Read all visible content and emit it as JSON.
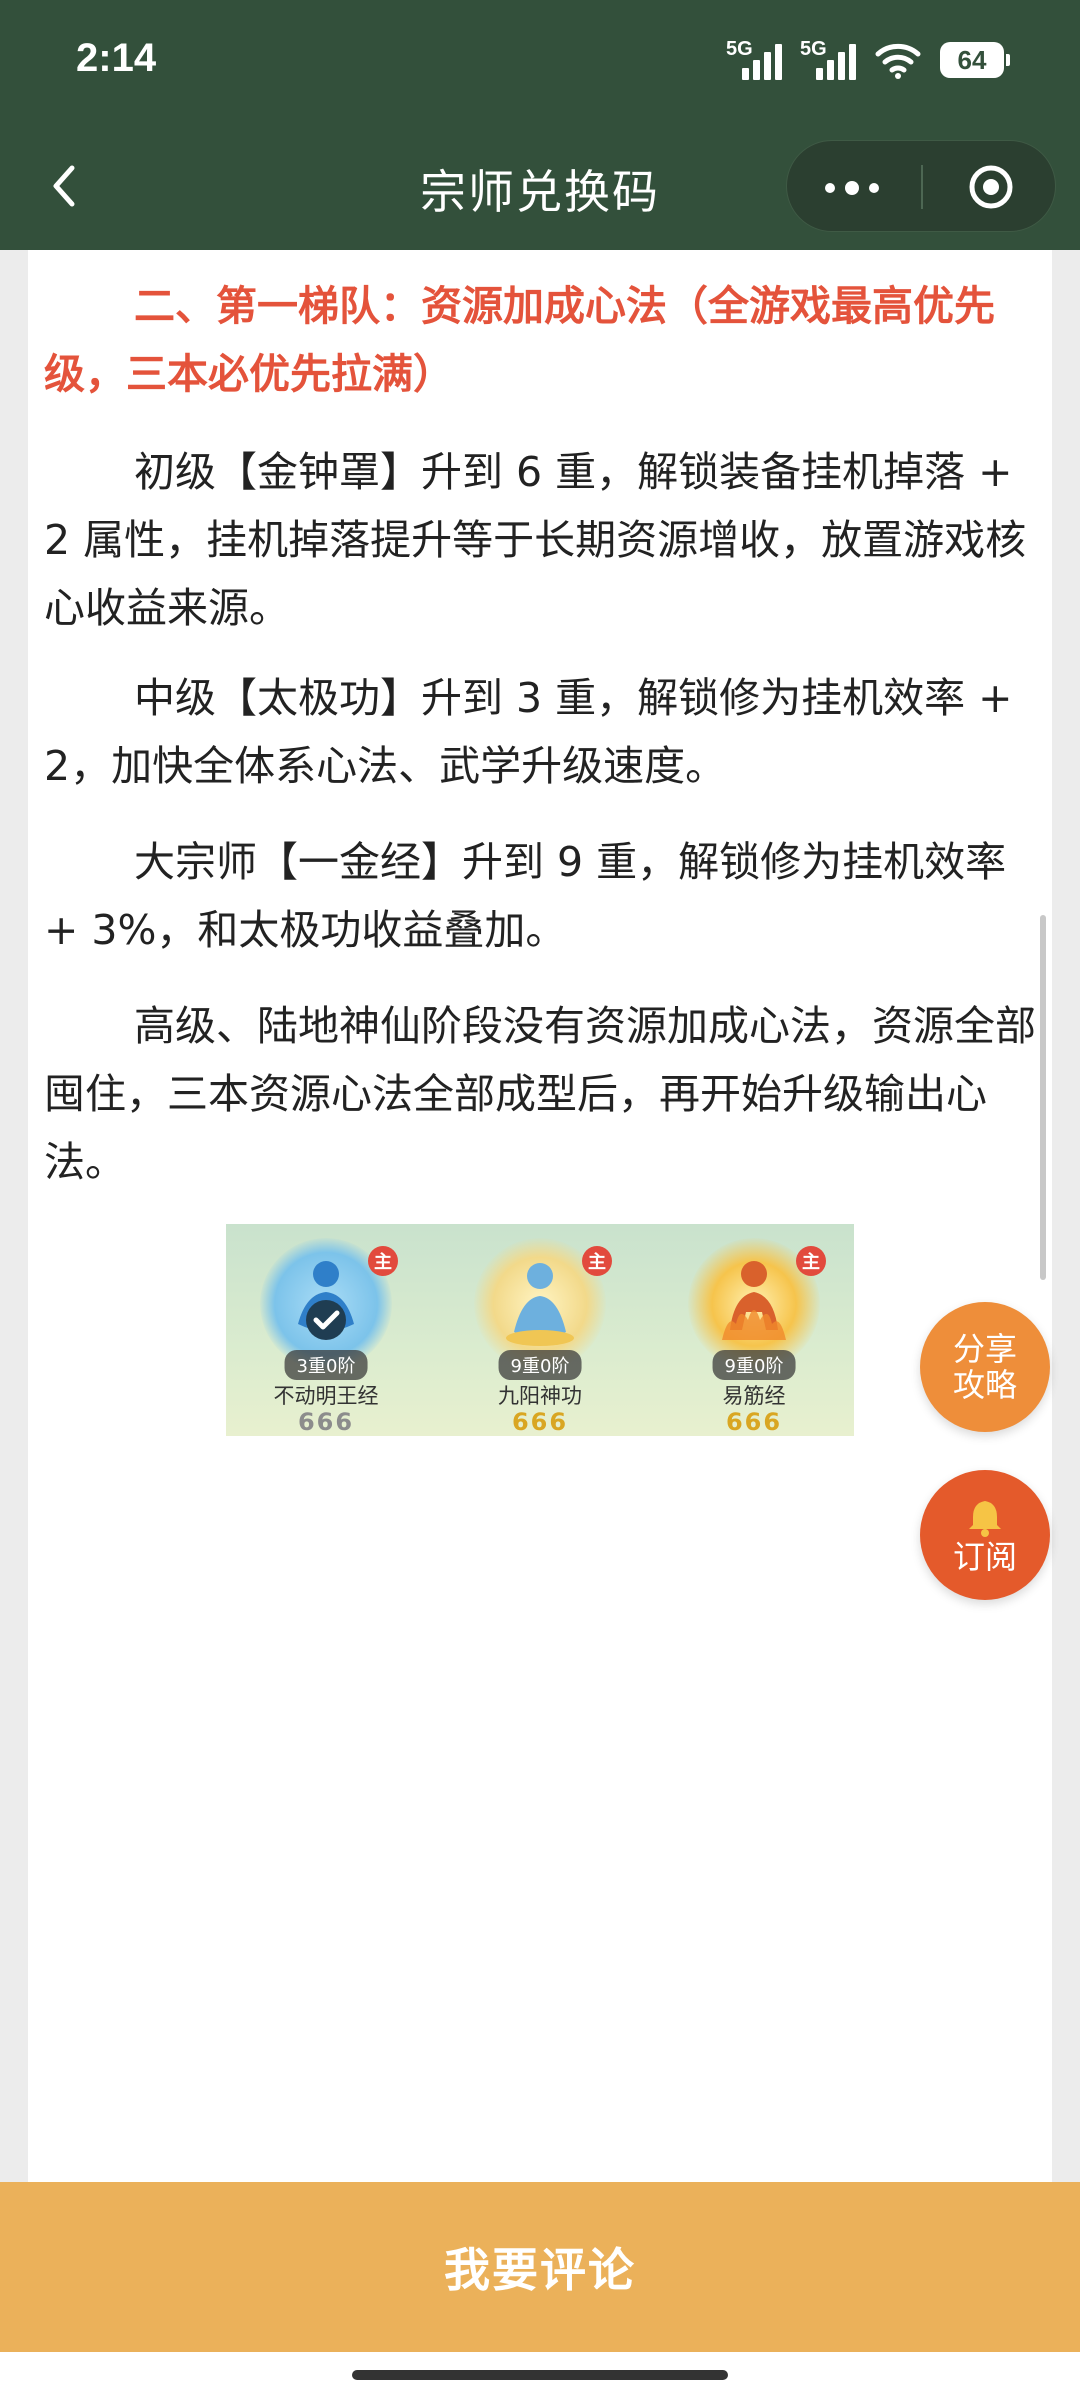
{
  "status_bar": {
    "time": "2:14",
    "signal1_label": "5G",
    "signal2_label": "5G",
    "battery": "64"
  },
  "nav": {
    "title": "宗师兑换码"
  },
  "article": {
    "heading": "二、第一梯队：资源加成心法（全游戏最高优先级，三本必优先拉满）",
    "paragraphs": [
      "初级【金钟罩】升到 6 重，解锁装备挂机掉落 + 2 属性，挂机掉落提升等于长期资源增收，放置游戏核心收益来源。",
      "中级【太极功】升到 3 重，解锁修为挂机效率 + 2，加快全体系心法、武学升级速度。",
      "大宗师【一金经】升到 9 重，解锁修为挂机效率 + 3%，和太极功收益叠加。",
      "高级、陆地神仙阶段没有资源加成心法，资源全部囤住，三本资源心法全部成型后，再开始升级输出心法。"
    ],
    "image_skills": [
      {
        "tier": "3重0阶",
        "name": "不动明王经",
        "badge": "主",
        "marks": "666",
        "icon": "meditating-figure-blue-check-icon"
      },
      {
        "tier": "9重0阶",
        "name": "九阳神功",
        "badge": "主",
        "marks": "666",
        "icon": "meditating-figure-lotus-icon"
      },
      {
        "tier": "9重0阶",
        "name": "易筋经",
        "badge": "主",
        "marks": "666",
        "icon": "monk-figure-fire-icon"
      }
    ]
  },
  "floating": {
    "share_line1": "分享",
    "share_line2": "攻略",
    "subscribe_label": "订阅",
    "subscribe_icon": "bell-icon"
  },
  "comment_bar": {
    "label": "我要评论"
  },
  "colors": {
    "header_bg": "#33503b",
    "heading_red": "#e4533b",
    "comment_bar": "#ebb15a",
    "share_orange": "#ee8e3a",
    "subscribe_orange": "#e45a2b"
  }
}
